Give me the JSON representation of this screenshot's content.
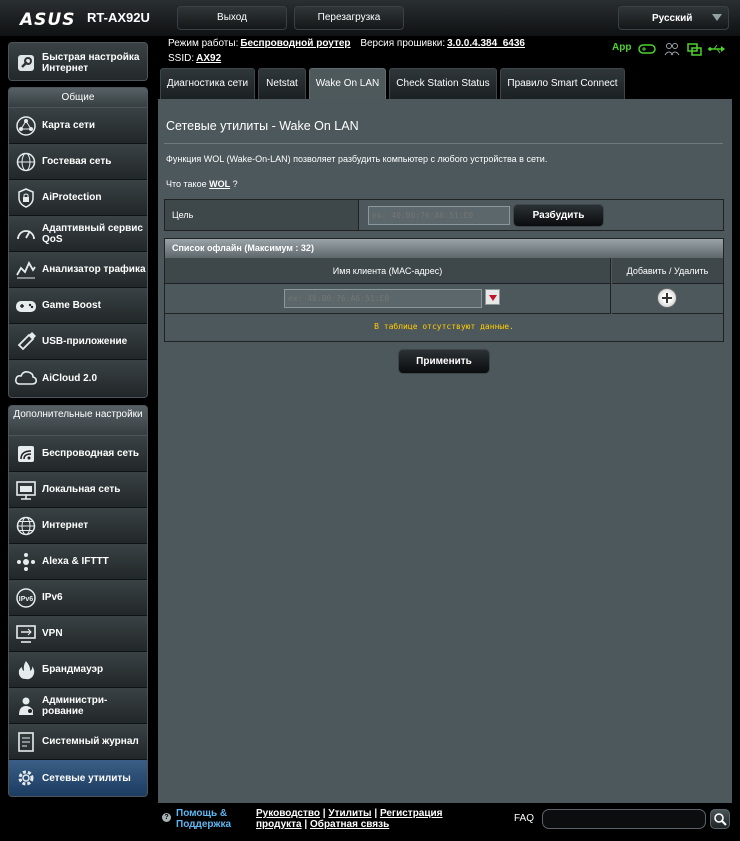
{
  "header": {
    "brand": "ASUS",
    "model": "RT-AX92U",
    "logout_label": "Выход",
    "reboot_label": "Перезагрузка",
    "language": "Русский"
  },
  "info": {
    "mode_label": "Режим работы:",
    "mode_value": "Беспроводной роутер",
    "firmware_label": "Версия прошивки:",
    "firmware_value": "3.0.0.4.384_6436",
    "ssid_label": "SSID:",
    "ssid_value": "AX92",
    "app_label": "App"
  },
  "sidebar": {
    "quick_setup": "Быстрая настройка Интернет",
    "general_title": "Общие",
    "general": [
      {
        "label": "Карта сети",
        "icon": "network-map-icon"
      },
      {
        "label": "Гостевая сеть",
        "icon": "globe-icon"
      },
      {
        "label": "AiProtection",
        "icon": "shield-lock-icon"
      },
      {
        "label": "Адаптивный сервис QoS",
        "icon": "speedometer-icon"
      },
      {
        "label": "Анализатор трафика",
        "icon": "traffic-analyzer-icon"
      },
      {
        "label": "Game Boost",
        "icon": "gamepad-icon"
      },
      {
        "label": "USB-приложение",
        "icon": "usb-icon"
      },
      {
        "label": "AiCloud 2.0",
        "icon": "cloud-icon"
      }
    ],
    "advanced_title": "Дополнительные настройки",
    "advanced": [
      {
        "label": "Беспроводная сеть",
        "icon": "wireless-icon"
      },
      {
        "label": "Локальная сеть",
        "icon": "lan-icon"
      },
      {
        "label": "Интернет",
        "icon": "globe-icon"
      },
      {
        "label": "Alexa & IFTTT",
        "icon": "alexa-icon"
      },
      {
        "label": "IPv6",
        "icon": "ipv6-icon"
      },
      {
        "label": "VPN",
        "icon": "vpn-icon"
      },
      {
        "label": "Брандмауэр",
        "icon": "firewall-icon"
      },
      {
        "label": "Администри- рование",
        "icon": "admin-icon"
      },
      {
        "label": "Системный журнал",
        "icon": "log-icon"
      },
      {
        "label": "Сетевые утилиты",
        "icon": "gear-icon"
      }
    ]
  },
  "tabs": [
    "Диагностика сети",
    "Netstat",
    "Wake On LAN",
    "Check Station Status",
    "Правило Smart Connect"
  ],
  "main": {
    "title": "Сетевые утилиты - Wake On LAN",
    "description": "Функция WOL (Wake-On-LAN) позволяет разбудить компьютер с любого устройства в сети.",
    "whatis_prefix": "Что такое",
    "whatis_link": "WOL",
    "whatis_suffix": "?",
    "target_label": "Цель",
    "target_placeholder": "ex: 40:B0:76:A6:51:E0",
    "wake_label": "Разбудить",
    "offline_title": "Список офлайн (Максимум : 32)",
    "col_client": "Имя клиента (МАС-адрес)",
    "col_add": "Добавить / Удалить",
    "mac_placeholder": "ex: 40:B0:76:A6:51:E0",
    "empty_message": "В таблице отсутствуют данные.",
    "apply_label": "Применить"
  },
  "footer": {
    "help": "Помощь & Поддержка",
    "links": [
      "Руководство",
      "Утилиты",
      "Регистрация продукта",
      "Обратная связь"
    ],
    "faq_label": "FAQ"
  }
}
